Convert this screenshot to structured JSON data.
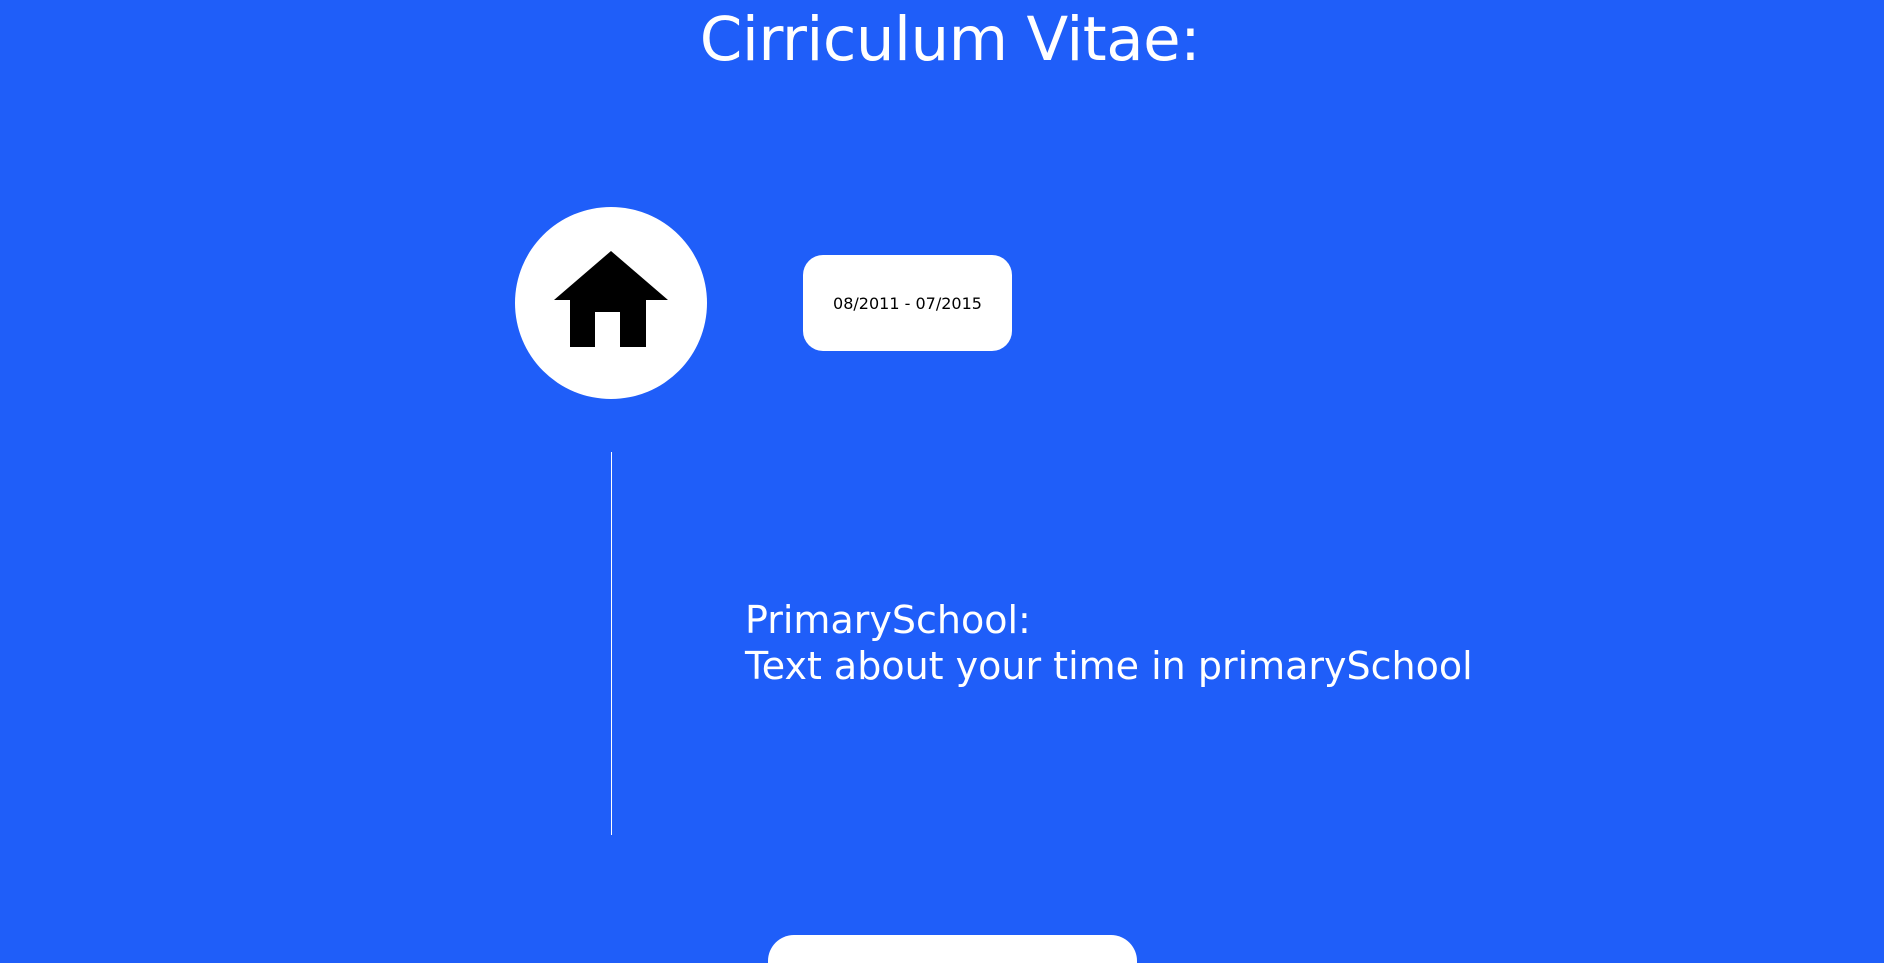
{
  "page": {
    "title": "Cirriculum Vitae:"
  },
  "timeline": {
    "entries": [
      {
        "icon": "home-icon",
        "date_range": "08/2011 - 07/2015",
        "heading": "PrimarySchool:",
        "description": "Text about your time in primarySchool"
      }
    ]
  },
  "colors": {
    "background": "#1f5ef9",
    "card": "#ffffff",
    "text_light": "#ffffff",
    "text_dark": "#000000"
  }
}
